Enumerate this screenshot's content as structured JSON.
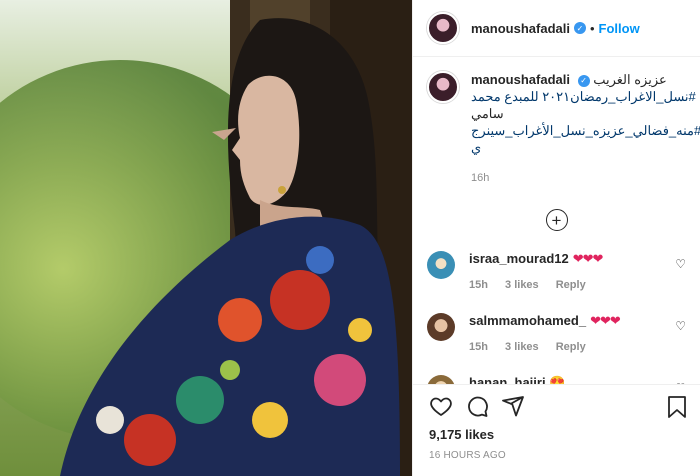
{
  "post": {
    "username": "manoushafadali",
    "verified_mark": "✓",
    "dot": "•",
    "follow_label": "Follow",
    "caption": {
      "username": "manoushafadali",
      "line1": "عزيزه الغريب",
      "line2": "#نسل_الاغراب_رمضان٢٠٢١ للمبدع محمد",
      "line3": "سامي",
      "line4": "#منه_فضالي_عزيزه_نسل_الأغراب_سينرج",
      "line5": "ي",
      "time": "16h"
    },
    "load_more": "+",
    "comments": [
      {
        "username": "israa_mourad12",
        "text": "❤❤❤",
        "time": "15h",
        "likes": "3 likes",
        "reply": "Reply",
        "avatar_color": "#3a8fb5"
      },
      {
        "username": "salmmamohamed_",
        "text": "❤❤❤",
        "time": "15h",
        "likes": "3 likes",
        "reply": "Reply",
        "avatar_color": "#b98a6a"
      },
      {
        "username": "hanan_hajiri",
        "text": "😍",
        "time": "",
        "likes": "",
        "reply": "",
        "avatar_color": "#c9a25a"
      }
    ],
    "likes_count": "9,175 likes",
    "posted_ago": "16 HOURS AGO",
    "icons": [
      "heart-icon",
      "comment-icon",
      "share-icon",
      "bookmark-icon"
    ]
  }
}
